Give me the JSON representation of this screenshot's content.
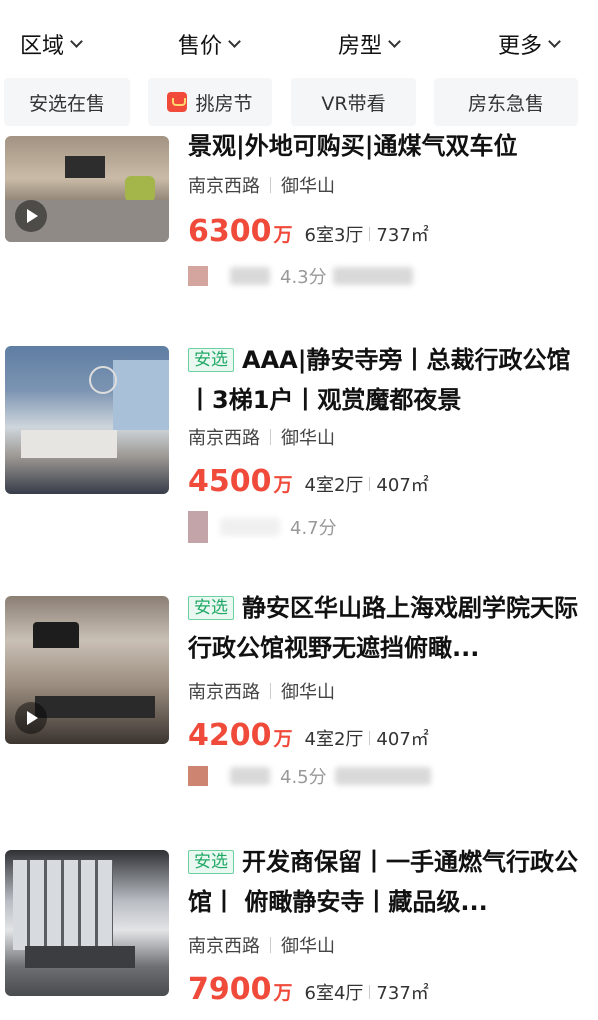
{
  "filters": [
    "区域",
    "售价",
    "房型",
    "更多"
  ],
  "tags": [
    "安选在售",
    "挑房节",
    "VR带看",
    "房东急售"
  ],
  "listings": [
    {
      "badge": "",
      "title": "景观|外地可购买|通煤气双车位",
      "district": "南京西路",
      "community": "御华山",
      "price": "6300",
      "unit": "万",
      "layout": "6室3厅",
      "area": "737㎡",
      "score": "4.3分",
      "has_video": true
    },
    {
      "badge": "安选",
      "title": "AAA|静安寺旁丨总裁行政公馆丨3梯1户丨观赏魔都夜景",
      "district": "南京西路",
      "community": "御华山",
      "price": "4500",
      "unit": "万",
      "layout": "4室2厅",
      "area": "407㎡",
      "score": "4.7分",
      "has_video": false
    },
    {
      "badge": "安选",
      "title": "静安区华山路上海戏剧学院天际行政公馆视野无遮挡俯瞰...",
      "district": "南京西路",
      "community": "御华山",
      "price": "4200",
      "unit": "万",
      "layout": "4室2厅",
      "area": "407㎡",
      "score": "4.5分",
      "has_video": true
    },
    {
      "badge": "安选",
      "title": "开发商保留丨一手通燃气行政公馆丨 俯瞰静安寺丨藏品级...",
      "district": "南京西路",
      "community": "御华山",
      "price": "7900",
      "unit": "万",
      "layout": "6室4厅",
      "area": "737㎡",
      "score": "",
      "has_video": false
    }
  ]
}
